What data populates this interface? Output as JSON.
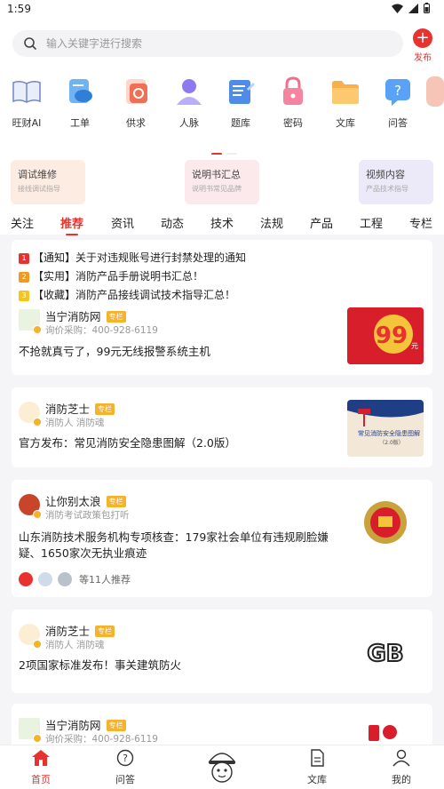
{
  "status_bar": {
    "time": "1:59"
  },
  "search": {
    "placeholder": "输入关键字进行搜索"
  },
  "publish": {
    "label": "发布"
  },
  "apps": [
    {
      "label": "旺财AI",
      "icon": "book-icon"
    },
    {
      "label": "工单",
      "icon": "cloud-doc-icon"
    },
    {
      "label": "供求",
      "icon": "supply-icon"
    },
    {
      "label": "人脉",
      "icon": "person-icon"
    },
    {
      "label": "题库",
      "icon": "question-bank-icon"
    },
    {
      "label": "密码",
      "icon": "lock-icon"
    },
    {
      "label": "文库",
      "icon": "folder-icon"
    },
    {
      "label": "问答",
      "icon": "qa-icon"
    }
  ],
  "banners": [
    {
      "title": "调试维修",
      "subtitle": "接线调试指导"
    },
    {
      "title": "说明书汇总",
      "subtitle": "说明书常见品牌"
    },
    {
      "title": "视频内容",
      "subtitle": "产品技术指导"
    }
  ],
  "tabs": [
    "关注",
    "推荐",
    "资讯",
    "动态",
    "技术",
    "法规",
    "产品",
    "工程",
    "专栏"
  ],
  "notices": [
    {
      "num": "1",
      "color": "#e8322f",
      "text": "【通知】关于对违规账号进行封禁处理的通知"
    },
    {
      "num": "2",
      "color": "#f39a1e",
      "text": "【实用】消防产品手册说明书汇总！"
    },
    {
      "num": "3",
      "color": "#f5c518",
      "text": "【收藏】消防产品接线调试技术指导汇总！"
    }
  ],
  "posts": [
    {
      "author": "当宁消防网",
      "tag": "专栏",
      "subtitle": "询价采购：400-928-6119",
      "title": "不抢就真亏了，99元无线报警系统主机",
      "thumb_text": "99",
      "thumb_unit": "元"
    },
    {
      "author": "消防芝士",
      "tag": "专栏",
      "subtitle": "消防人 消防魂",
      "title": "官方发布：常见消防安全隐患图解（2.0版）",
      "thumb_text": "常见消防安全隐患图解",
      "thumb_sub": "（2.0版）"
    },
    {
      "author": "让你别太浪",
      "tag": "专栏",
      "subtitle": "消防考试政策包打听",
      "title": "山东消防技术服务机构专项核查：179家社会单位有违规刷脸嫌疑、1650家次无执业痕迹",
      "likers": "等11人推荐"
    },
    {
      "author": "消防芝士",
      "tag": "专栏",
      "subtitle": "消防人 消防魂",
      "title": "2项国家标准发布！事关建筑防火",
      "thumb_text": "GB"
    },
    {
      "author": "当宁消防网",
      "tag": "专栏",
      "subtitle": "询价采购：400-928-6119"
    }
  ],
  "bottom_nav": [
    {
      "label": "首页",
      "icon": "home-icon",
      "active": true
    },
    {
      "label": "问答",
      "icon": "question-icon",
      "active": false
    },
    {
      "label": "",
      "icon": "mascot-icon",
      "active": false
    },
    {
      "label": "文库",
      "icon": "document-icon",
      "active": false
    },
    {
      "label": "我的",
      "icon": "user-icon",
      "active": false
    }
  ],
  "colors": {
    "accent": "#e8322f",
    "tag": "#f5b22b"
  }
}
